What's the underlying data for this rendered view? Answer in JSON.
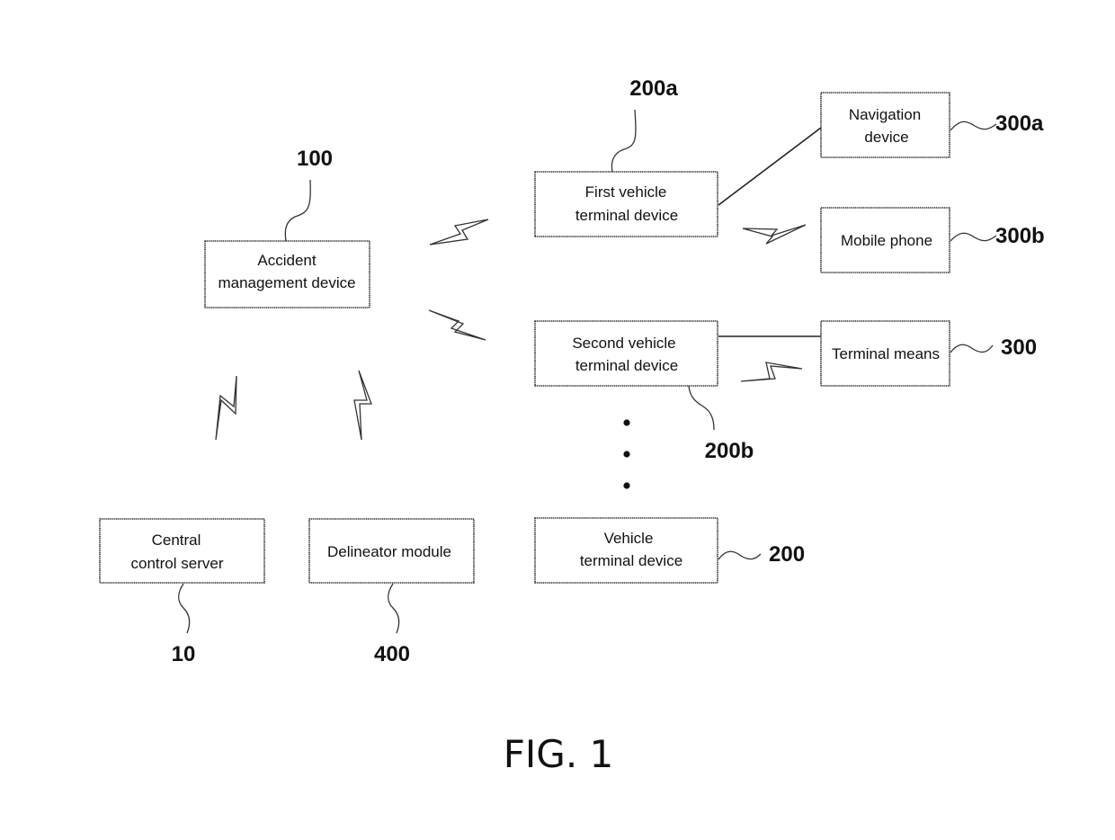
{
  "figure": {
    "caption": "FIG. 1"
  },
  "nodes": {
    "accident": {
      "lines": [
        "Accident",
        "management device"
      ],
      "ref": "100"
    },
    "first_vehicle": {
      "lines": [
        "First vehicle",
        "terminal device"
      ],
      "ref": "200a"
    },
    "navigation": {
      "lines": [
        "Navigation",
        "device"
      ],
      "ref": "300a"
    },
    "mobile": {
      "lines": [
        "Mobile phone"
      ],
      "ref": "300b"
    },
    "second_vehicle": {
      "lines": [
        "Second vehicle",
        "terminal device"
      ],
      "ref": "200b"
    },
    "terminal_means": {
      "lines": [
        "Terminal means"
      ],
      "ref": "300"
    },
    "vehicle": {
      "lines": [
        "Vehicle",
        "terminal device"
      ],
      "ref": "200"
    },
    "central": {
      "lines": [
        "Central",
        "control server"
      ],
      "ref": "10"
    },
    "delineator": {
      "lines": [
        "Delineator module"
      ],
      "ref": "400"
    }
  },
  "connections": [
    {
      "from": "first_vehicle",
      "to": "navigation",
      "type": "wired"
    },
    {
      "from": "first_vehicle",
      "to": "mobile",
      "type": "wireless"
    },
    {
      "from": "second_vehicle",
      "to": "terminal_means",
      "type": "wired"
    },
    {
      "from": "second_vehicle",
      "to": "terminal_means",
      "type": "wireless"
    },
    {
      "from": "accident",
      "to": "first_vehicle",
      "type": "wireless"
    },
    {
      "from": "accident",
      "to": "second_vehicle",
      "type": "wireless"
    },
    {
      "from": "accident",
      "to": "central",
      "type": "wireless"
    },
    {
      "from": "accident",
      "to": "delineator",
      "type": "wireless"
    }
  ],
  "ellipsis_icon": "vertical-ellipsis"
}
